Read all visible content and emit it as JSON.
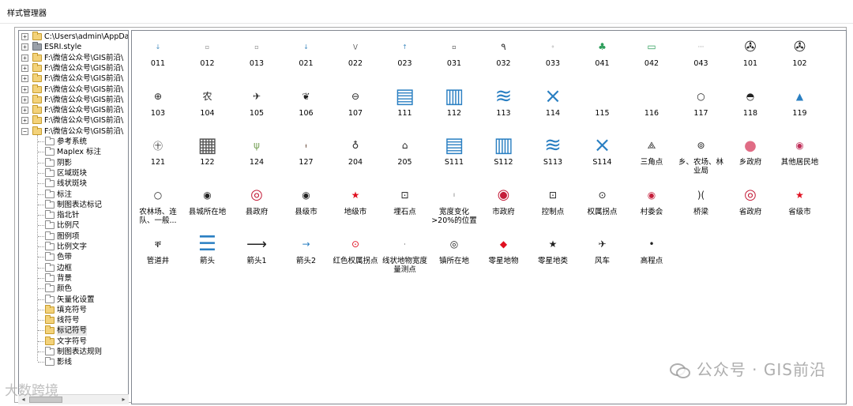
{
  "window": {
    "title": "样式管理器"
  },
  "tree": {
    "items": [
      {
        "label": "C:\\Users\\admin\\AppData\\",
        "kind": "root"
      },
      {
        "label": "ESRI.style",
        "kind": "root"
      },
      {
        "label": "F:\\微信公众号\\GIS前沿\\",
        "kind": "root"
      },
      {
        "label": "F:\\微信公众号\\GIS前沿\\",
        "kind": "root"
      },
      {
        "label": "F:\\微信公众号\\GIS前沿\\",
        "kind": "root"
      },
      {
        "label": "F:\\微信公众号\\GIS前沿\\",
        "kind": "root"
      },
      {
        "label": "F:\\微信公众号\\GIS前沿\\",
        "kind": "root"
      },
      {
        "label": "F:\\微信公众号\\GIS前沿\\",
        "kind": "root"
      },
      {
        "label": "F:\\微信公众号\\GIS前沿\\",
        "kind": "root"
      },
      {
        "label": "F:\\微信公众号\\GIS前沿\\",
        "kind": "root-expanded"
      }
    ],
    "children": [
      {
        "label": "参考系统",
        "folder": "empty"
      },
      {
        "label": "Maplex 标注",
        "folder": "empty"
      },
      {
        "label": "阴影",
        "folder": "empty"
      },
      {
        "label": "区域斑块",
        "folder": "empty"
      },
      {
        "label": "线状斑块",
        "folder": "empty"
      },
      {
        "label": "标注",
        "folder": "empty"
      },
      {
        "label": "制图表达标记",
        "folder": "empty"
      },
      {
        "label": "指北针",
        "folder": "empty"
      },
      {
        "label": "比例尺",
        "folder": "empty"
      },
      {
        "label": "图例项",
        "folder": "empty"
      },
      {
        "label": "比例文字",
        "folder": "empty"
      },
      {
        "label": "色带",
        "folder": "empty"
      },
      {
        "label": "边框",
        "folder": "empty"
      },
      {
        "label": "背景",
        "folder": "empty"
      },
      {
        "label": "颜色",
        "folder": "empty"
      },
      {
        "label": "矢量化设置",
        "folder": "empty"
      },
      {
        "label": "填充符号",
        "folder": "yellow"
      },
      {
        "label": "线符号",
        "folder": "yellow"
      },
      {
        "label": "标记符号",
        "folder": "yellow",
        "selected": true
      },
      {
        "label": "文字符号",
        "folder": "yellow"
      },
      {
        "label": "制图表达规则",
        "folder": "empty"
      },
      {
        "label": "影线",
        "folder": "empty"
      }
    ]
  },
  "symbols": [
    {
      "label": "011",
      "icon": "down-arrow-tiny-icon",
      "glyph": "↓",
      "color": "#4a90c2"
    },
    {
      "label": "012",
      "icon": "small-dot-icon",
      "glyph": "▫",
      "color": "#777777"
    },
    {
      "label": "013",
      "icon": "small-dot-icon",
      "glyph": "▫",
      "color": "#777777"
    },
    {
      "label": "021",
      "icon": "down-arrow-tiny-icon",
      "glyph": "↓",
      "color": "#4a90c2"
    },
    {
      "label": "022",
      "icon": "v-mark-icon",
      "glyph": "\\/",
      "color": "#333333"
    },
    {
      "label": "023",
      "icon": "up-arrow-tiny-icon",
      "glyph": "↑",
      "color": "#4a90c2"
    },
    {
      "label": "031",
      "icon": "small-square-icon",
      "glyph": "▫",
      "color": "#333333"
    },
    {
      "label": "032",
      "icon": "wrench-icon",
      "glyph": "٩",
      "color": "#333333"
    },
    {
      "label": "033",
      "icon": "small-diamond-icon",
      "glyph": "◦",
      "color": "#333333"
    },
    {
      "label": "041",
      "icon": "terrain-green-icon",
      "glyph": "♣",
      "color": "#2e9e5b"
    },
    {
      "label": "042",
      "icon": "rail-green-icon",
      "glyph": "▭",
      "color": "#2e9e5b"
    },
    {
      "label": "043",
      "icon": "dotted-line-icon",
      "glyph": "···",
      "color": "#777777"
    },
    {
      "label": "101",
      "icon": "mercedes-icon",
      "glyph": "✇",
      "color": "#222222"
    },
    {
      "label": "102",
      "icon": "mercedes-icon",
      "glyph": "✇",
      "color": "#222222"
    },
    {
      "label": "103",
      "icon": "circle-grid-icon",
      "glyph": "⊕",
      "color": "#222222"
    },
    {
      "label": "104",
      "icon": "agri-icon",
      "glyph": "农",
      "color": "#222222"
    },
    {
      "label": "105",
      "icon": "airport-icon",
      "glyph": "✈",
      "color": "#222222"
    },
    {
      "label": "106",
      "icon": "tree-icon",
      "glyph": "❦",
      "color": "#222222"
    },
    {
      "label": "107",
      "icon": "circle-line-icon",
      "glyph": "⊖",
      "color": "#222222"
    },
    {
      "label": "111",
      "icon": "blue-pattern-a-icon",
      "glyph": "▤",
      "color": "#2a7fc2"
    },
    {
      "label": "112",
      "icon": "blue-pattern-b-icon",
      "glyph": "▥",
      "color": "#2a7fc2"
    },
    {
      "label": "113",
      "icon": "blue-wave-icon",
      "glyph": "≋",
      "color": "#2a7fc2"
    },
    {
      "label": "114",
      "icon": "blue-x-icon",
      "glyph": "⨯",
      "color": "#2a7fc2"
    },
    {
      "label": "115",
      "icon": "empty-icon",
      "glyph": "",
      "color": "#222222"
    },
    {
      "label": "116",
      "icon": "empty-icon",
      "glyph": "",
      "color": "#222222"
    },
    {
      "label": "117",
      "icon": "ring-icon",
      "glyph": "○",
      "color": "#222222"
    },
    {
      "label": "118",
      "icon": "half-circle-icon",
      "glyph": "◓",
      "color": "#222222"
    },
    {
      "label": "119",
      "icon": "blue-triangle-icon",
      "glyph": "▲",
      "color": "#2a7fc2"
    },
    {
      "label": "121",
      "icon": "circle-sym-icon",
      "glyph": "㊉",
      "color": "#222222"
    },
    {
      "label": "122",
      "icon": "doc-stack-icon",
      "glyph": "▦",
      "color": "#555555"
    },
    {
      "label": "124",
      "icon": "grass-icon",
      "glyph": "ψ",
      "color": "#7aa35c"
    },
    {
      "label": "127",
      "icon": "tiny-t-icon",
      "glyph": "ᵼ",
      "color": "#553322"
    },
    {
      "label": "204",
      "icon": "bulb-icon",
      "glyph": "♁",
      "color": "#222222"
    },
    {
      "label": "205",
      "icon": "house-circle-icon",
      "glyph": "⌂",
      "color": "#222222"
    },
    {
      "label": "S111",
      "icon": "blue-pattern-a-icon",
      "glyph": "▤",
      "color": "#2a7fc2"
    },
    {
      "label": "S112",
      "icon": "blue-pattern-b-icon",
      "glyph": "▥",
      "color": "#2a7fc2"
    },
    {
      "label": "S113",
      "icon": "blue-wave-icon",
      "glyph": "≋",
      "color": "#2a7fc2"
    },
    {
      "label": "S114",
      "icon": "blue-x-icon",
      "glyph": "⨯",
      "color": "#2a7fc2"
    },
    {
      "label": "三角点",
      "icon": "triangle-point-icon",
      "glyph": "⟁",
      "color": "#222222"
    },
    {
      "label": "乡、农场、林业局",
      "icon": "small-circle-dot-icon",
      "glyph": "⊚",
      "color": "#222222"
    },
    {
      "label": "乡政府",
      "icon": "pink-circle-icon",
      "glyph": "●",
      "color": "#e06c85"
    },
    {
      "label": "其他居民地",
      "icon": "small-pink-dot-icon",
      "glyph": "◉",
      "color": "#c0305a"
    },
    {
      "label": "农林场、连队、一般...",
      "icon": "open-circle-icon",
      "glyph": "○",
      "color": "#222222"
    },
    {
      "label": "县城所在地",
      "icon": "dot-circle-icon",
      "glyph": "◉",
      "color": "#222222"
    },
    {
      "label": "县政府",
      "icon": "red-double-circle-icon",
      "glyph": "◎",
      "color": "#c41e3a"
    },
    {
      "label": "县级市",
      "icon": "dot-circle-icon",
      "glyph": "◉",
      "color": "#222222"
    },
    {
      "label": "地级市",
      "icon": "red-star-icon",
      "glyph": "★",
      "color": "#e01020"
    },
    {
      "label": "埋石点",
      "icon": "square-dot-icon",
      "glyph": "⊡",
      "color": "#222222"
    },
    {
      "label": "宽度变化>20%的位置",
      "icon": "tick-icon",
      "glyph": "ı",
      "color": "#777777"
    },
    {
      "label": "市政府",
      "icon": "big-red-circle-icon",
      "glyph": "◉",
      "color": "#c41e3a"
    },
    {
      "label": "控制点",
      "icon": "square-dot-icon",
      "glyph": "⊡",
      "color": "#222222"
    },
    {
      "label": "权属拐点",
      "icon": "circle-dot-icon",
      "glyph": "⊙",
      "color": "#222222"
    },
    {
      "label": "村委会",
      "icon": "red-dot-circle-icon",
      "glyph": "◉",
      "color": "#c41e3a"
    },
    {
      "label": "桥梁",
      "icon": "bridge-icon",
      "glyph": ")(",
      "color": "#222222"
    },
    {
      "label": "省政府",
      "icon": "big-red-ring-icon",
      "glyph": "◎",
      "color": "#c41e3a"
    },
    {
      "label": "省级市",
      "icon": "red-star-icon",
      "glyph": "★",
      "color": "#e01020"
    },
    {
      "label": "管道井",
      "icon": "well-icon",
      "glyph": "ቐ",
      "color": "#222222"
    },
    {
      "label": "箭头",
      "icon": "lines-doc-icon",
      "glyph": "☰",
      "color": "#2a7fc2"
    },
    {
      "label": "箭头1",
      "icon": "long-arrow-icon",
      "glyph": "⟶",
      "color": "#222222"
    },
    {
      "label": "箭头2",
      "icon": "blue-arrow-icon",
      "glyph": "→",
      "color": "#2a7fc2"
    },
    {
      "label": "红色权属拐点",
      "icon": "red-small-ring-icon",
      "glyph": "⊙",
      "color": "#e01020"
    },
    {
      "label": "线状地物宽度量测点",
      "icon": "tiny-dot-icon",
      "glyph": "·",
      "color": "#222222"
    },
    {
      "label": "镇所在地",
      "icon": "circle-target-icon",
      "glyph": "◎",
      "color": "#222222"
    },
    {
      "label": "零星地物",
      "icon": "red-diamond-icon",
      "glyph": "◆",
      "color": "#e01020"
    },
    {
      "label": "零星地类",
      "icon": "black-star-icon",
      "glyph": "★",
      "color": "#222222"
    },
    {
      "label": "风车",
      "icon": "windmill-icon",
      "glyph": "✈",
      "color": "#222222"
    },
    {
      "label": "高程点",
      "icon": "elevation-dot-icon",
      "glyph": "•",
      "color": "#222222"
    }
  ],
  "watermark": {
    "right": "公众号 · GIS前沿",
    "left": "大数跨境"
  }
}
